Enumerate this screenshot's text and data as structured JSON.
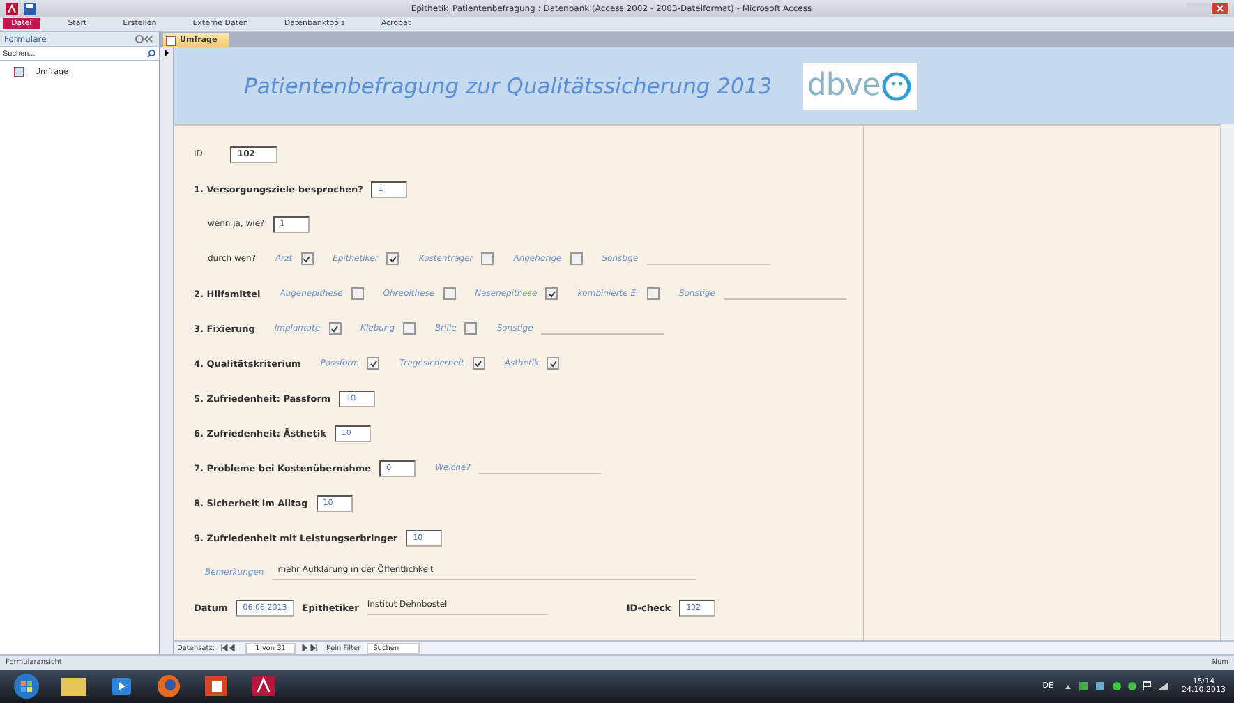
{
  "window": {
    "title": "Epithetik_Patientenbefragung : Datenbank (Access 2002 - 2003-Dateiformat) - Microsoft Access"
  },
  "ribbon_tabs": [
    {
      "label": "Datei",
      "selected": true
    },
    {
      "label": "Start",
      "selected": false
    },
    {
      "label": "Erstellen",
      "selected": false
    },
    {
      "label": "Externe Daten",
      "selected": false
    },
    {
      "label": "Datenbanktools",
      "selected": false
    },
    {
      "label": "Acrobat",
      "selected": false
    }
  ],
  "navigation": {
    "title": "Formulare",
    "search": {
      "placeholder": "Suchen..."
    },
    "items": [
      {
        "label": "Umfrage",
        "selected": false
      }
    ]
  },
  "document_tab": {
    "label": "Umfrage"
  },
  "form": {
    "title": "Patientenbefragung zur Qualitätssicherung 2013",
    "logo": "dbve",
    "id_label": "ID",
    "id_value": "102",
    "rows": [
      {
        "indent": false,
        "items": [
          {
            "kind": "bold",
            "text": "1. Versorgungsziele besprochen?"
          },
          {
            "kind": "field",
            "text": "1"
          }
        ]
      },
      {
        "indent": true,
        "items": [
          {
            "kind": "plain",
            "text": "wenn ja, wie?"
          },
          {
            "kind": "field",
            "text": "1"
          }
        ]
      },
      {
        "indent": true,
        "items": [
          {
            "kind": "plain",
            "text": "durch wen?"
          },
          {
            "kind": "option",
            "text": "Arzt",
            "checked": true
          },
          {
            "kind": "option",
            "text": "Epithetiker",
            "checked": true
          },
          {
            "kind": "option",
            "text": "Kostenträger",
            "checked": false
          },
          {
            "kind": "option",
            "text": "Angehörige",
            "checked": false
          },
          {
            "kind": "hint",
            "text": "Sonstige"
          },
          {
            "kind": "line"
          }
        ]
      },
      {
        "indent": false,
        "items": [
          {
            "kind": "bold",
            "text": "2. Hilfsmittel"
          },
          {
            "kind": "option",
            "text": "Augenepithese",
            "checked": false
          },
          {
            "kind": "option",
            "text": "Ohrepithese",
            "checked": false
          },
          {
            "kind": "option",
            "text": "Nasenepithese",
            "checked": true
          },
          {
            "kind": "option",
            "text": "kombinierte E.",
            "checked": false
          },
          {
            "kind": "hint",
            "text": "Sonstige"
          },
          {
            "kind": "line"
          }
        ]
      },
      {
        "indent": false,
        "items": [
          {
            "kind": "bold",
            "text": "3. Fixierung"
          },
          {
            "kind": "option",
            "text": "Implantate",
            "checked": true
          },
          {
            "kind": "option",
            "text": "Klebung",
            "checked": false
          },
          {
            "kind": "option",
            "text": "Brille",
            "checked": false
          },
          {
            "kind": "hint",
            "text": "Sonstige"
          },
          {
            "kind": "line"
          }
        ]
      },
      {
        "indent": false,
        "items": [
          {
            "kind": "bold",
            "text": "4. Qualitätskriterium"
          },
          {
            "kind": "option",
            "text": "Passform",
            "checked": true
          },
          {
            "kind": "option",
            "text": "Tragesicherheit",
            "checked": true
          },
          {
            "kind": "option",
            "text": "Ästhetik",
            "checked": true
          }
        ]
      },
      {
        "indent": false,
        "items": [
          {
            "kind": "bold",
            "text": "5. Zufriedenheit: Passform"
          },
          {
            "kind": "field",
            "text": "10"
          }
        ]
      },
      {
        "indent": false,
        "items": [
          {
            "kind": "bold",
            "text": "6. Zufriedenheit: Ästhetik"
          },
          {
            "kind": "field",
            "text": "10"
          }
        ]
      },
      {
        "indent": false,
        "items": [
          {
            "kind": "bold",
            "text": "7. Probleme bei Kostenübernahme"
          },
          {
            "kind": "field",
            "text": "0"
          },
          {
            "kind": "hint",
            "text": "Welche?"
          },
          {
            "kind": "line"
          }
        ]
      },
      {
        "indent": false,
        "items": [
          {
            "kind": "bold",
            "text": "8. Sicherheit im Alltag"
          },
          {
            "kind": "field",
            "text": "10"
          }
        ]
      },
      {
        "indent": false,
        "items": [
          {
            "kind": "bold",
            "text": "9. Zufriedenheit mit Leistungserbringer"
          },
          {
            "kind": "field",
            "text": "10"
          }
        ]
      },
      {
        "indent": false,
        "items": [
          {
            "kind": "hint",
            "text": "Bemerkungen"
          },
          {
            "kind": "wide",
            "text": "mehr Aufklärung in der Öffentlichkeit"
          }
        ]
      },
      {
        "indent": false,
        "items": [
          {
            "kind": "bold",
            "text": "Datum"
          },
          {
            "kind": "field",
            "text": "06.06.2013"
          },
          {
            "kind": "bold",
            "text": "Epithetiker"
          },
          {
            "kind": "underlined",
            "text": "Institut Dehnbostel"
          },
          {
            "kind": "bold",
            "text": "ID-check"
          },
          {
            "kind": "field",
            "text": "102"
          }
        ]
      }
    ]
  },
  "record_nav": {
    "label": "Datensatz:",
    "position": "1 von 31",
    "filter": "Kein Filter",
    "search": "Suchen"
  },
  "status_bar": {
    "left": "Formularansicht",
    "right": "Num"
  },
  "taskbar": {
    "language": "DE",
    "time": "15:14",
    "date": "24.10.2013"
  }
}
